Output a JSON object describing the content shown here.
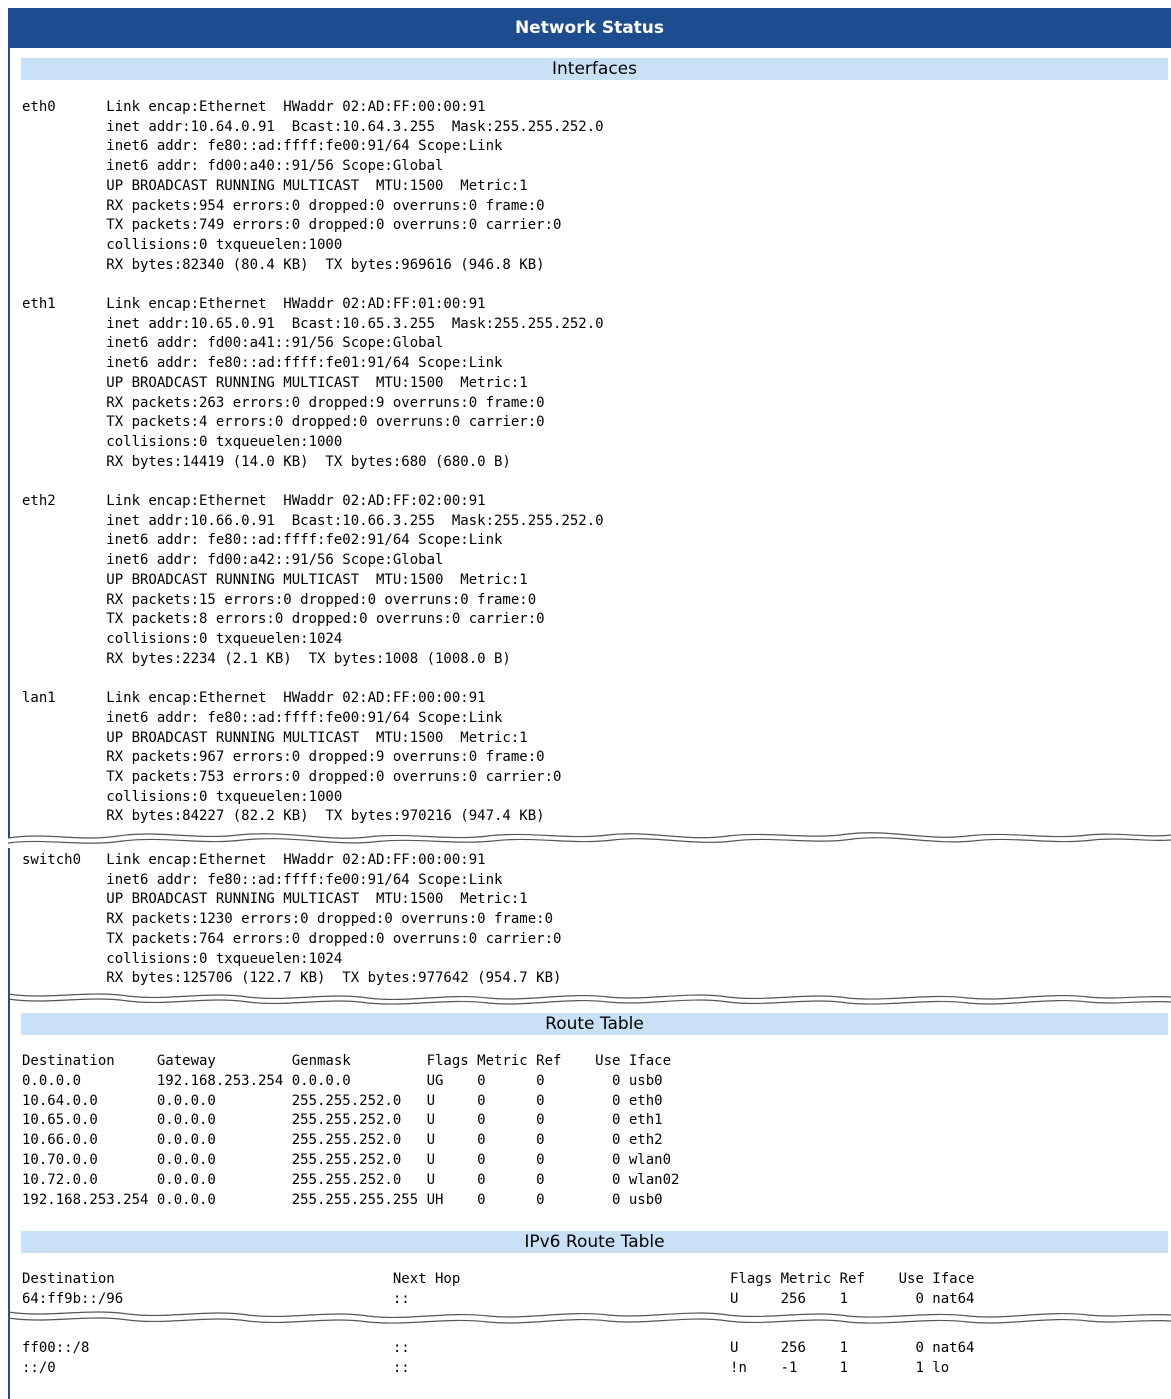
{
  "title": "Network Status",
  "sections": {
    "interfaces": "Interfaces",
    "route_table": "Route Table",
    "ipv6_route_table": "IPv6 Route Table"
  },
  "interfaces_block_1": "eth0      Link encap:Ethernet  HWaddr 02:AD:FF:00:00:91\n          inet addr:10.64.0.91  Bcast:10.64.3.255  Mask:255.255.252.0\n          inet6 addr: fe80::ad:ffff:fe00:91/64 Scope:Link\n          inet6 addr: fd00:a40::91/56 Scope:Global\n          UP BROADCAST RUNNING MULTICAST  MTU:1500  Metric:1\n          RX packets:954 errors:0 dropped:0 overruns:0 frame:0\n          TX packets:749 errors:0 dropped:0 overruns:0 carrier:0\n          collisions:0 txqueuelen:1000\n          RX bytes:82340 (80.4 KB)  TX bytes:969616 (946.8 KB)\n\neth1      Link encap:Ethernet  HWaddr 02:AD:FF:01:00:91\n          inet addr:10.65.0.91  Bcast:10.65.3.255  Mask:255.255.252.0\n          inet6 addr: fd00:a41::91/56 Scope:Global\n          inet6 addr: fe80::ad:ffff:fe01:91/64 Scope:Link\n          UP BROADCAST RUNNING MULTICAST  MTU:1500  Metric:1\n          RX packets:263 errors:0 dropped:9 overruns:0 frame:0\n          TX packets:4 errors:0 dropped:0 overruns:0 carrier:0\n          collisions:0 txqueuelen:1000\n          RX bytes:14419 (14.0 KB)  TX bytes:680 (680.0 B)\n\neth2      Link encap:Ethernet  HWaddr 02:AD:FF:02:00:91\n          inet addr:10.66.0.91  Bcast:10.66.3.255  Mask:255.255.252.0\n          inet6 addr: fe80::ad:ffff:fe02:91/64 Scope:Link\n          inet6 addr: fd00:a42::91/56 Scope:Global\n          UP BROADCAST RUNNING MULTICAST  MTU:1500  Metric:1\n          RX packets:15 errors:0 dropped:0 overruns:0 frame:0\n          TX packets:8 errors:0 dropped:0 overruns:0 carrier:0\n          collisions:0 txqueuelen:1024\n          RX bytes:2234 (2.1 KB)  TX bytes:1008 (1008.0 B)\n\nlan1      Link encap:Ethernet  HWaddr 02:AD:FF:00:00:91\n          inet6 addr: fe80::ad:ffff:fe00:91/64 Scope:Link\n          UP BROADCAST RUNNING MULTICAST  MTU:1500  Metric:1\n          RX packets:967 errors:0 dropped:9 overruns:0 frame:0\n          TX packets:753 errors:0 dropped:0 overruns:0 carrier:0\n          collisions:0 txqueuelen:1000\n          RX bytes:84227 (82.2 KB)  TX bytes:970216 (947.4 KB)",
  "interfaces_block_2": "switch0   Link encap:Ethernet  HWaddr 02:AD:FF:00:00:91\n          inet6 addr: fe80::ad:ffff:fe00:91/64 Scope:Link\n          UP BROADCAST RUNNING MULTICAST  MTU:1500  Metric:1\n          RX packets:1230 errors:0 dropped:0 overruns:0 frame:0\n          TX packets:764 errors:0 dropped:0 overruns:0 carrier:0\n          collisions:0 txqueuelen:1024\n          RX bytes:125706 (122.7 KB)  TX bytes:977642 (954.7 KB)",
  "route_table_text": "Destination     Gateway         Genmask         Flags Metric Ref    Use Iface\n0.0.0.0         192.168.253.254 0.0.0.0         UG    0      0        0 usb0\n10.64.0.0       0.0.0.0         255.255.252.0   U     0      0        0 eth0\n10.65.0.0       0.0.0.0         255.255.252.0   U     0      0        0 eth1\n10.66.0.0       0.0.0.0         255.255.252.0   U     0      0        0 eth2\n10.70.0.0       0.0.0.0         255.255.252.0   U     0      0        0 wlan0\n10.72.0.0       0.0.0.0         255.255.252.0   U     0      0        0 wlan02\n192.168.253.254 0.0.0.0         255.255.255.255 UH    0      0        0 usb0",
  "ipv6_route_table_head": "Destination                                 Next Hop                                Flags Metric Ref    Use Iface\n64:ff9b::/96                                ::                                      U     256    1        0 nat64",
  "ipv6_route_table_tail": "ff00::/8                                    ::                                      U     256    1        0 nat64\n::/0                                        ::                                      !n    -1     1        1 lo",
  "colors": {
    "title_bar": "#1d4d8f",
    "section_header": "#c9e1f6"
  }
}
